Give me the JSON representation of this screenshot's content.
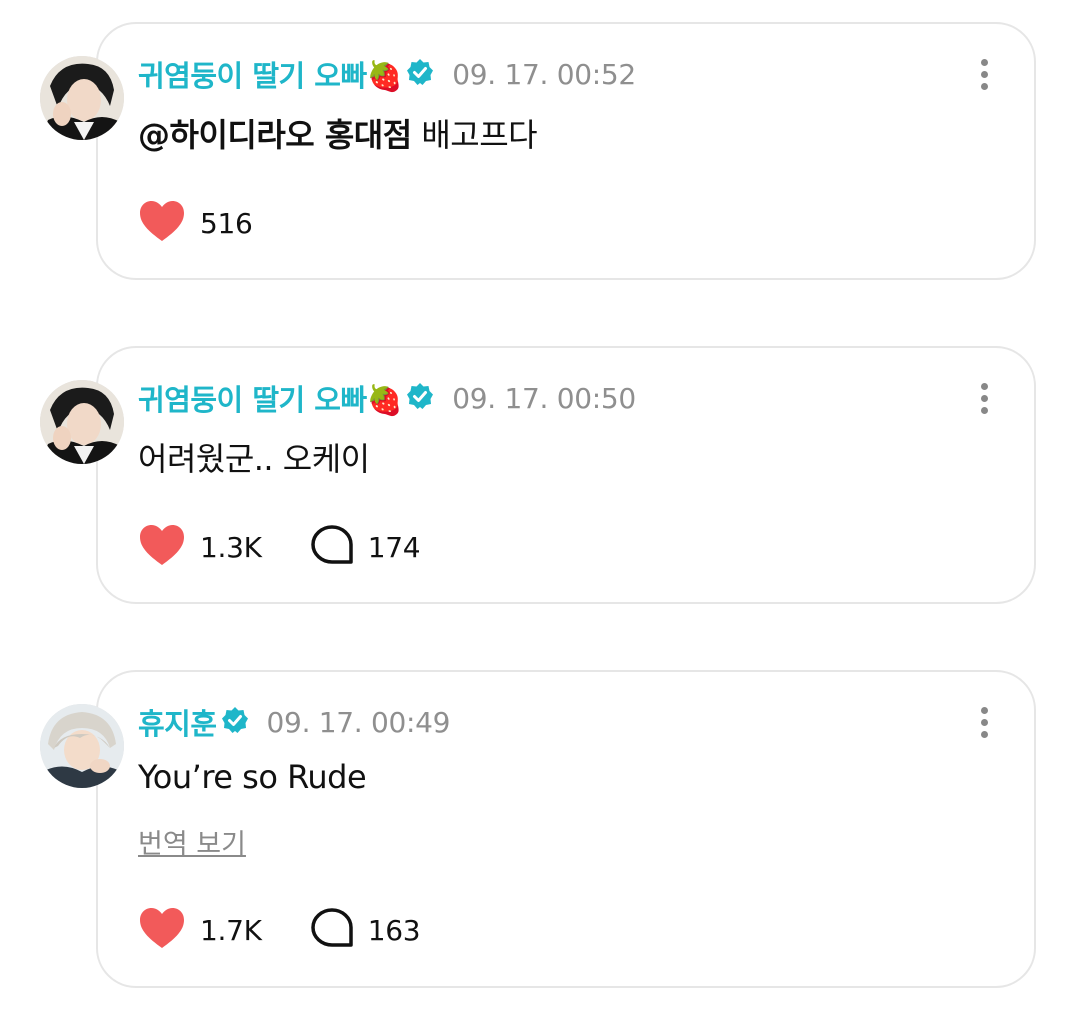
{
  "posts": [
    {
      "author": "귀염둥이 딸기 오빠🍓",
      "time": "09. 17. 00:52",
      "mention": "@하이디라오 홍대점",
      "text": " 배고프다",
      "likes": "516",
      "avatar_icon": "avatar-photo"
    },
    {
      "author": "귀염둥이 딸기 오빠🍓",
      "time": "09. 17. 00:50",
      "text": "어려웠군.. 오케이",
      "likes": "1.3K",
      "comments": "174",
      "avatar_icon": "avatar-photo"
    },
    {
      "author": "휴지훈",
      "time": "09. 17. 00:49",
      "text": "You’re so Rude",
      "translate": "번역 보기",
      "likes": "1.7K",
      "comments": "163",
      "avatar_icon": "avatar-photo"
    }
  ],
  "icons": {
    "verified": "verified-badge-icon",
    "like": "heart-icon",
    "comment": "comment-bubble-icon",
    "more": "more-vertical-icon"
  },
  "colors": {
    "author": "#1fb6c9",
    "verified": "#1fb6c9",
    "heart": "#f25a5a",
    "time": "#8f8f8f",
    "card_border": "#e6e6e6"
  }
}
